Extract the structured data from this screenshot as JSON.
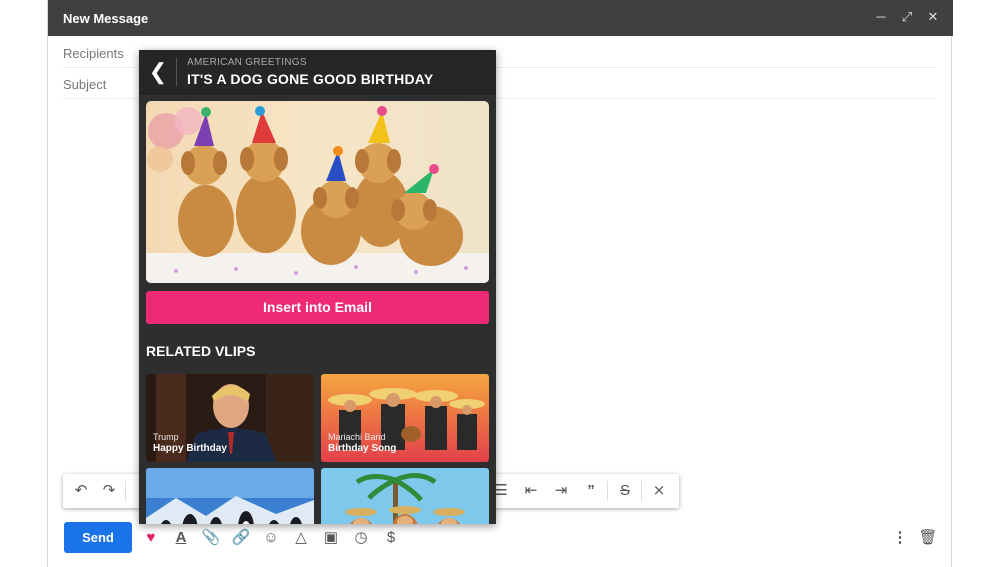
{
  "window": {
    "title": "New Message"
  },
  "fields": {
    "recipients": "Recipients",
    "subject": "Subject"
  },
  "vlip_panel": {
    "brand": "AMERICAN GREETINGS",
    "title": "IT'S A DOG GONE GOOD BIRTHDAY",
    "insert_label": "Insert into Email",
    "related_heading": "RELATED VLIPS",
    "related": [
      {
        "creator": "Trump",
        "title": "Happy Birthday"
      },
      {
        "creator": "Mariachi Band",
        "title": "Birthday Song"
      },
      {
        "creator": "",
        "title": ""
      },
      {
        "creator": "",
        "title": ""
      }
    ]
  },
  "bottom_bar": {
    "send_label": "Send"
  },
  "colors": {
    "send": "#1a73e8",
    "insert": "#ee2a75",
    "titlebar": "#404040",
    "panel": "#2e2e2e"
  }
}
